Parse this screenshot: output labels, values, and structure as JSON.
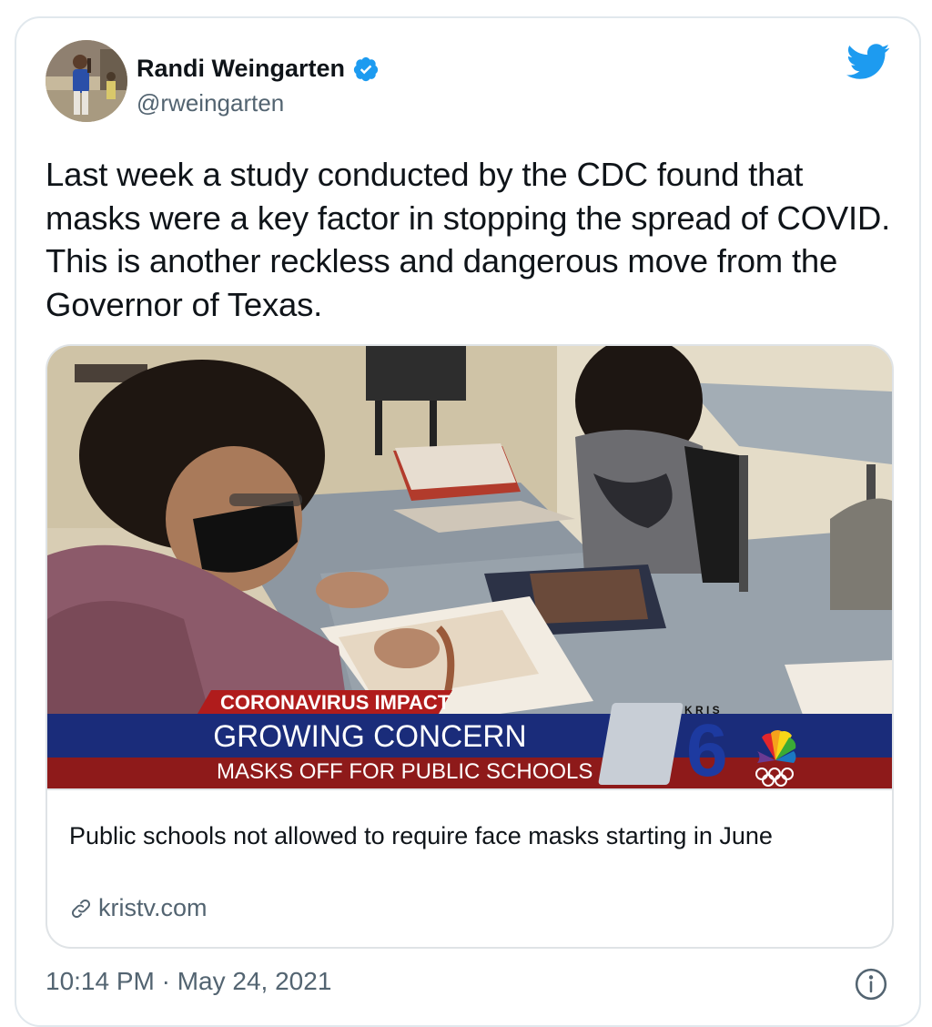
{
  "author": {
    "name": "Randi Weingarten",
    "handle": "@rweingarten"
  },
  "icons": {
    "verified": "verified-badge-icon",
    "brand": "twitter-bird-icon",
    "link": "link-icon",
    "info": "info-icon"
  },
  "colors": {
    "twitter_blue": "#1d9bf0",
    "text_secondary": "#536471",
    "border": "#e1e8ed"
  },
  "tweet": {
    "text": "Last week a study conducted by the CDC found that masks were a key factor in stopping the spread of COVID. This is another reckless and dangerous move from the Governor of Texas.",
    "timestamp": "10:14 PM · May 24, 2021"
  },
  "link_card": {
    "image_overlay": {
      "kicker": "CORONAVIRUS IMPACT",
      "headline": "GROWING CONCERN",
      "subhead": "MASKS OFF FOR PUBLIC SCHOOLS",
      "station_letters": "KRIS",
      "station_number": "6"
    },
    "title": "Public schools not allowed to require face masks starting in June",
    "domain": "kristv.com"
  }
}
